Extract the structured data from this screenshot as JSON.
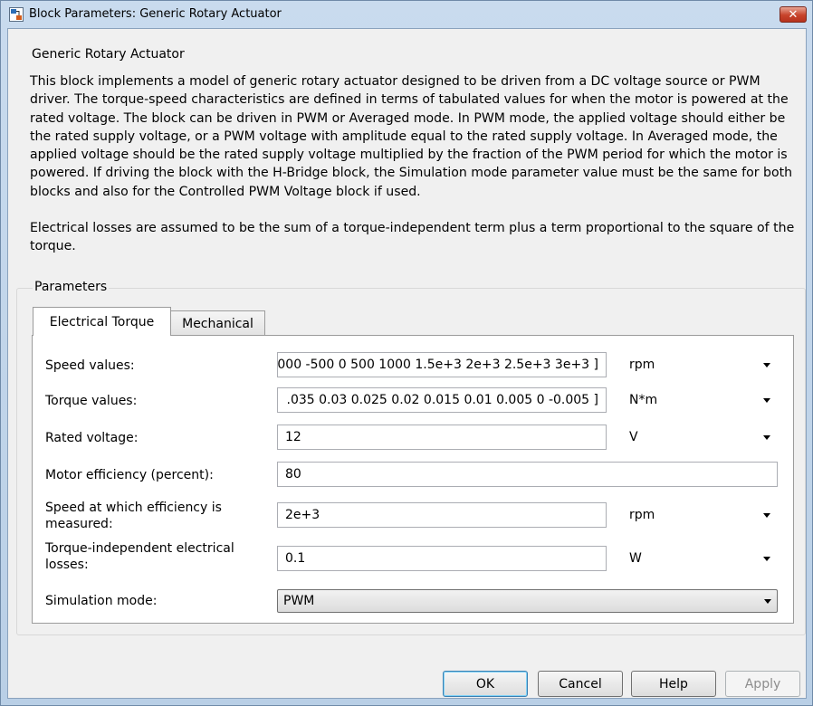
{
  "window": {
    "title": "Block Parameters: Generic Rotary Actuator",
    "close_glyph": "✕"
  },
  "description": {
    "group_title": "Generic Rotary Actuator",
    "paragraph1": "This block implements a model of generic rotary actuator designed to be driven from a DC voltage source or PWM driver. The torque-speed characteristics are defined in terms of tabulated values for when the motor is powered at the rated voltage. The block can be driven in PWM or Averaged mode. In PWM mode, the applied voltage should either be the rated supply voltage, or a PWM voltage with amplitude equal to the rated supply voltage. In Averaged mode, the applied voltage should be the rated supply voltage multiplied by the fraction of the PWM period for which the motor is powered. If driving the block with the H-Bridge block, the Simulation mode parameter value must be the same for both blocks and also for the Controlled PWM Voltage block if used.",
    "paragraph2": "Electrical losses are assumed to be the sum of a torque-independent term plus a term proportional to the square of the torque."
  },
  "parameters": {
    "group_title": "Parameters",
    "tabs": [
      {
        "label": "Electrical Torque",
        "active": true
      },
      {
        "label": "Mechanical",
        "active": false
      }
    ],
    "rows": {
      "speed": {
        "label": "Speed values:",
        "value": "000 -500 0 500 1000 1.5e+3 2e+3 2.5e+3 3e+3 ]",
        "unit": "rpm"
      },
      "torque": {
        "label": "Torque values:",
        "value": ".035 0.03 0.025 0.02 0.015 0.01 0.005 0 -0.005 ]",
        "unit": "N*m"
      },
      "rated_voltage": {
        "label": "Rated voltage:",
        "value": "12",
        "unit": "V"
      },
      "efficiency": {
        "label": "Motor efficiency (percent):",
        "value": "80"
      },
      "speed_efficiency": {
        "label_line1": "Speed at which efficiency is",
        "label_line2": "measured:",
        "value": "2e+3",
        "unit": "rpm"
      },
      "losses": {
        "label_line1": "Torque-independent electrical",
        "label_line2": "losses:",
        "value": "0.1",
        "unit": "W"
      },
      "sim_mode": {
        "label": "Simulation mode:",
        "value": "PWM"
      }
    }
  },
  "buttons": {
    "ok": "OK",
    "cancel": "Cancel",
    "help": "Help",
    "apply": "Apply"
  },
  "colors": {
    "title_bar": "#c9dbee",
    "close_button": "#c7432b",
    "client_bg": "#f0f0f0",
    "ok_focus": "#3c7fb1",
    "disabled_text": "#8d8d8d"
  }
}
